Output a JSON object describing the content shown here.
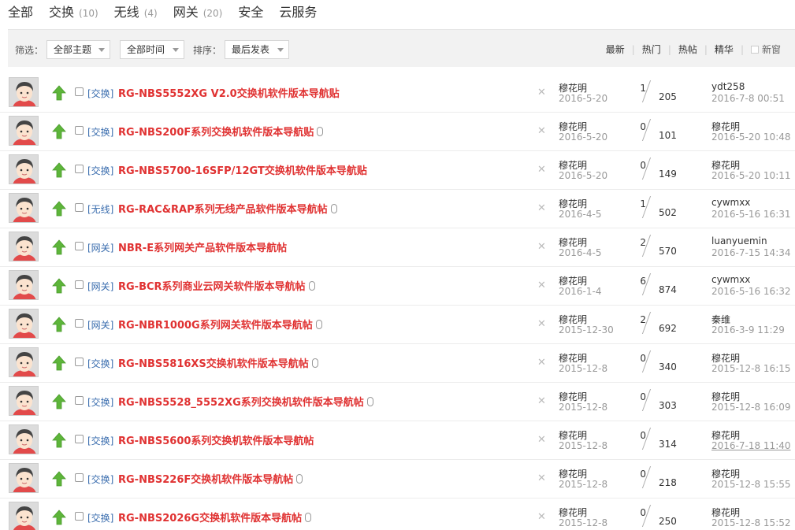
{
  "tabs": [
    {
      "label": "全部",
      "count": ""
    },
    {
      "label": "交换",
      "count": "(10)"
    },
    {
      "label": "无线",
      "count": "(4)"
    },
    {
      "label": "网关",
      "count": "(20)"
    },
    {
      "label": "安全",
      "count": ""
    },
    {
      "label": "云服务",
      "count": ""
    }
  ],
  "filter": {
    "filter_label": "筛选：",
    "topic_select": "全部主题",
    "time_select": "全部时间",
    "sort_label": "排序：",
    "sort_select": "最后发表"
  },
  "sort_links": {
    "latest": "最新",
    "hot": "热门",
    "hotpost": "热帖",
    "digest": "精华",
    "new_window": "新窗"
  },
  "colors": {
    "title": "#e03232",
    "tag": "#3a6dae",
    "arrow": "#5db53a",
    "filter_bg": "#f2f2f2"
  },
  "threads": [
    {
      "tag": "[交换]",
      "title": "RG-NBS5552XG V2.0交换机软件版本导航贴",
      "attach": false,
      "author": "穆花明",
      "date": "2016-5-20",
      "replies": "1",
      "views": "205",
      "last_user": "ydt258",
      "last_time": "2016-7-8 00:51",
      "underline": false
    },
    {
      "tag": "[交换]",
      "title": "RG-NBS200F系列交换机软件版本导航贴",
      "attach": true,
      "author": "穆花明",
      "date": "2016-5-20",
      "replies": "0",
      "views": "101",
      "last_user": "穆花明",
      "last_time": "2016-5-20 10:48",
      "underline": false
    },
    {
      "tag": "[交换]",
      "title": "RG-NBS5700-16SFP/12GT交换机软件版本导航贴",
      "attach": false,
      "author": "穆花明",
      "date": "2016-5-20",
      "replies": "0",
      "views": "149",
      "last_user": "穆花明",
      "last_time": "2016-5-20 10:11",
      "underline": false
    },
    {
      "tag": "[无线]",
      "title": "RG-RAC&RAP系列无线产品软件版本导航帖",
      "attach": true,
      "author": "穆花明",
      "date": "2016-4-5",
      "replies": "1",
      "views": "502",
      "last_user": "cywmxx",
      "last_time": "2016-5-16 16:31",
      "underline": false
    },
    {
      "tag": "[网关]",
      "title": "NBR-E系列网关产品软件版本导航帖",
      "attach": false,
      "author": "穆花明",
      "date": "2016-4-5",
      "replies": "2",
      "views": "570",
      "last_user": "luanyuemin",
      "last_time": "2016-7-15 14:34",
      "underline": false
    },
    {
      "tag": "[网关]",
      "title": "RG-BCR系列商业云网关软件版本导航帖",
      "attach": true,
      "author": "穆花明",
      "date": "2016-1-4",
      "replies": "6",
      "views": "874",
      "last_user": "cywmxx",
      "last_time": "2016-5-16 16:32",
      "underline": false
    },
    {
      "tag": "[网关]",
      "title": "RG-NBR1000G系列网关软件版本导航帖",
      "attach": true,
      "author": "穆花明",
      "date": "2015-12-30",
      "replies": "2",
      "views": "692",
      "last_user": "秦维",
      "last_time": "2016-3-9 11:29",
      "underline": false
    },
    {
      "tag": "[交换]",
      "title": "RG-NBS5816XS交换机软件版本导航帖",
      "attach": true,
      "author": "穆花明",
      "date": "2015-12-8",
      "replies": "0",
      "views": "340",
      "last_user": "穆花明",
      "last_time": "2015-12-8 16:15",
      "underline": false
    },
    {
      "tag": "[交换]",
      "title": "RG-NBS5528_5552XG系列交换机软件版本导航帖",
      "attach": true,
      "author": "穆花明",
      "date": "2015-12-8",
      "replies": "0",
      "views": "303",
      "last_user": "穆花明",
      "last_time": "2015-12-8 16:09",
      "underline": false
    },
    {
      "tag": "[交换]",
      "title": "RG-NBS5600系列交换机软件版本导航帖",
      "attach": false,
      "author": "穆花明",
      "date": "2015-12-8",
      "replies": "0",
      "views": "314",
      "last_user": "穆花明",
      "last_time": "2016-7-18 11:40",
      "underline": true
    },
    {
      "tag": "[交换]",
      "title": "RG-NBS226F交换机软件版本导航帖",
      "attach": true,
      "author": "穆花明",
      "date": "2015-12-8",
      "replies": "0",
      "views": "218",
      "last_user": "穆花明",
      "last_time": "2015-12-8 15:55",
      "underline": false
    },
    {
      "tag": "[交换]",
      "title": "RG-NBS2026G交换机软件版本导航帖",
      "attach": true,
      "author": "穆花明",
      "date": "2015-12-8",
      "replies": "0",
      "views": "250",
      "last_user": "穆花明",
      "last_time": "2015-12-8 15:52",
      "underline": false
    }
  ]
}
